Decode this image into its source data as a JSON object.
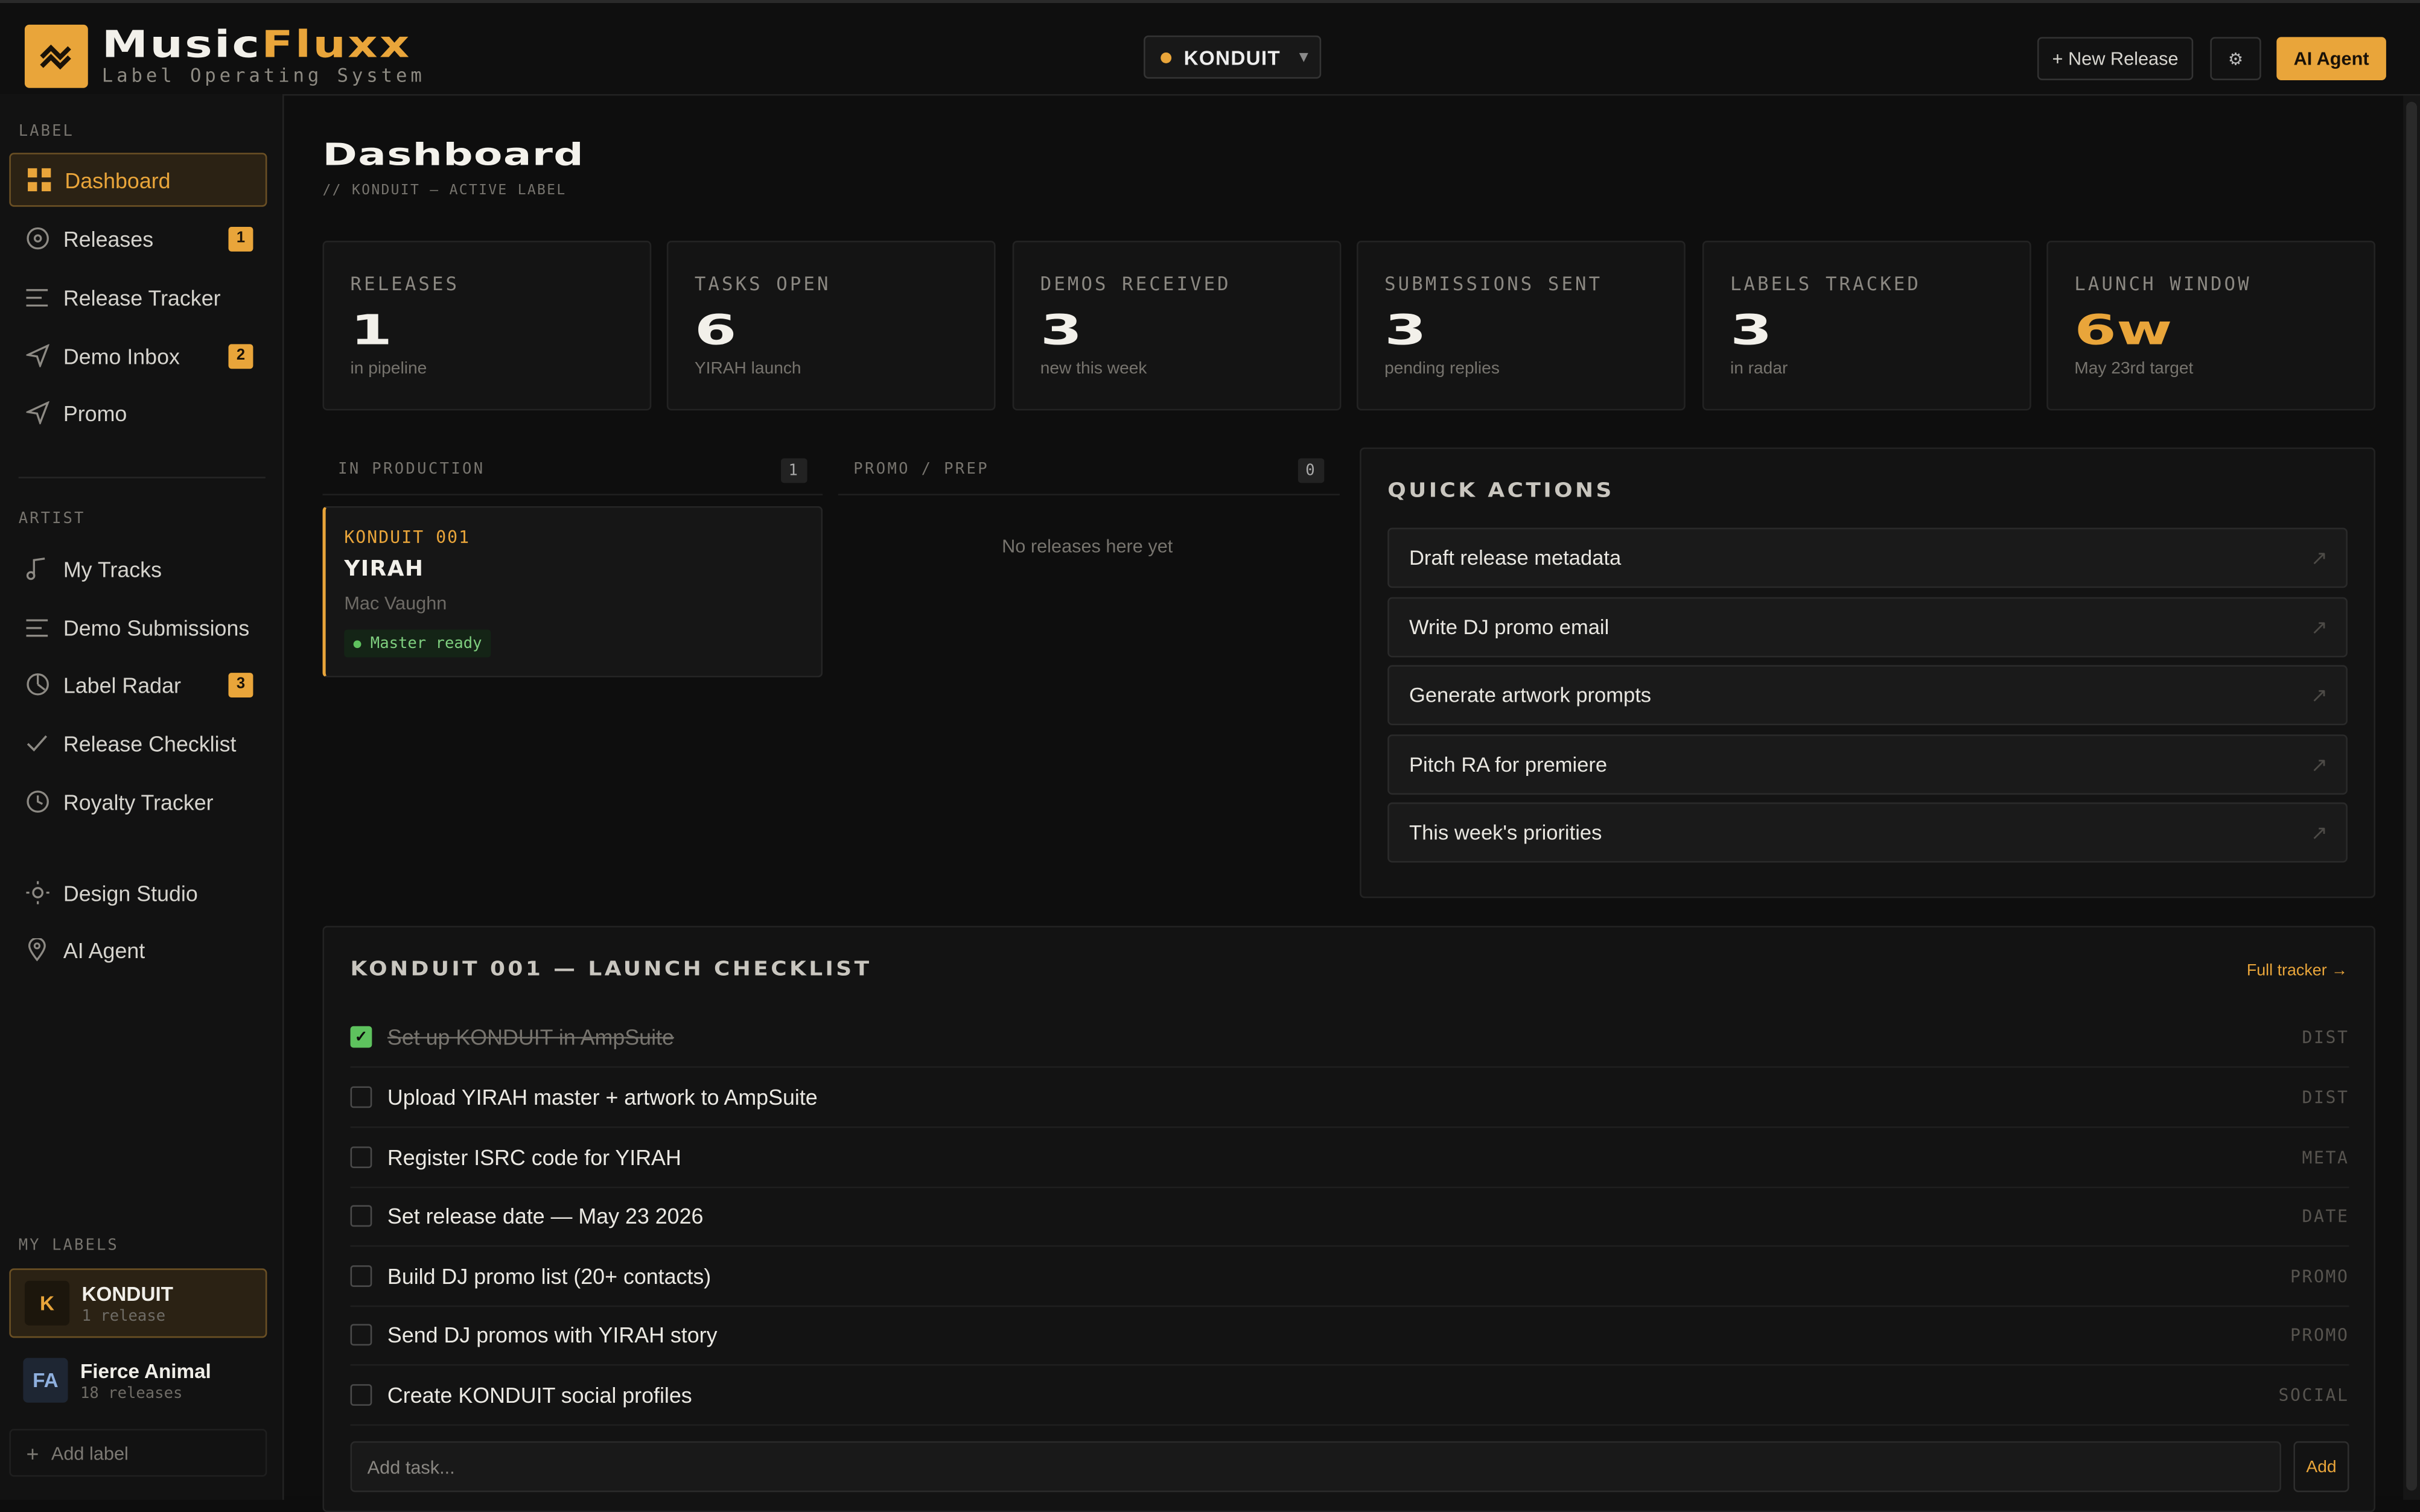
{
  "app": {
    "name_part1": "Music",
    "name_part2": "Fluxx",
    "subtitle": "Label Operating System",
    "accent": "#e9a53a"
  },
  "header": {
    "label_selector": "KONDUIT",
    "new_release": "+ New Release",
    "settings_icon": "gear-icon",
    "ai_agent": "AI Agent"
  },
  "sidebar": {
    "label_section": "LABEL",
    "label_items": [
      {
        "label": "Dashboard",
        "icon": "grid-icon",
        "active": true
      },
      {
        "label": "Releases",
        "icon": "disc-icon",
        "badge": "1"
      },
      {
        "label": "Release Tracker",
        "icon": "list-icon"
      },
      {
        "label": "Demo Inbox",
        "icon": "send-icon",
        "badge": "2"
      },
      {
        "label": "Promo",
        "icon": "send-icon"
      }
    ],
    "artist_section": "ARTIST",
    "artist_items": [
      {
        "label": "My Tracks",
        "icon": "music-note-icon"
      },
      {
        "label": "Demo Submissions",
        "icon": "list-icon"
      },
      {
        "label": "Label Radar",
        "icon": "radar-icon",
        "badge": "3"
      },
      {
        "label": "Release Checklist",
        "icon": "check-icon"
      },
      {
        "label": "Royalty Tracker",
        "icon": "clock-icon"
      }
    ],
    "tool_items": [
      {
        "label": "Design Studio",
        "icon": "sun-icon"
      },
      {
        "label": "AI Agent",
        "icon": "pin-icon"
      }
    ],
    "my_labels_section": "MY LABELS",
    "labels": [
      {
        "initials": "K",
        "name": "KONDUIT",
        "count": "1 release"
      },
      {
        "initials": "FA",
        "name": "Fierce Animal",
        "count": "18 releases"
      }
    ],
    "add_label": "Add label"
  },
  "main": {
    "title": "Dashboard",
    "subtitle": "// KONDUIT — ACTIVE LABEL",
    "stats": [
      {
        "label": "RELEASES",
        "value": "1",
        "note": "in pipeline"
      },
      {
        "label": "TASKS OPEN",
        "value": "6",
        "note": "YIRAH launch"
      },
      {
        "label": "DEMOS RECEIVED",
        "value": "3",
        "note": "new this week"
      },
      {
        "label": "SUBMISSIONS SENT",
        "value": "3",
        "note": "pending replies"
      },
      {
        "label": "LABELS TRACKED",
        "value": "3",
        "note": "in radar"
      },
      {
        "label": "LAUNCH WINDOW",
        "value": "6w",
        "note": "May 23rd target"
      }
    ],
    "columns": [
      {
        "title": "IN PRODUCTION",
        "count": "1"
      },
      {
        "title": "PROMO / PREP",
        "count": "0",
        "empty": "No releases here yet"
      }
    ],
    "release_card": {
      "catalog": "KONDUIT 001",
      "title": "YIRAH",
      "artist": "Mac Vaughn",
      "status": "Master ready"
    },
    "quick_actions": {
      "title": "QUICK ACTIONS",
      "items": [
        "Draft release metadata",
        "Write DJ promo email",
        "Generate artwork prompts",
        "Pitch RA for premiere",
        "This week's priorities"
      ]
    },
    "checklist": {
      "title": "KONDUIT 001 — LAUNCH CHECKLIST",
      "full_tracker": "Full tracker →",
      "tasks": [
        {
          "text": "Set up KONDUIT in AmpSuite",
          "tag": "DIST",
          "done": true
        },
        {
          "text": "Upload YIRAH master + artwork to AmpSuite",
          "tag": "DIST",
          "done": false
        },
        {
          "text": "Register ISRC code for YIRAH",
          "tag": "META",
          "done": false
        },
        {
          "text": "Set release date — May 23 2026",
          "tag": "DATE",
          "done": false
        },
        {
          "text": "Build DJ promo list (20+ contacts)",
          "tag": "PROMO",
          "done": false
        },
        {
          "text": "Send DJ promos with YIRAH story",
          "tag": "PROMO",
          "done": false
        },
        {
          "text": "Create KONDUIT social profiles",
          "tag": "SOCIAL",
          "done": false
        }
      ],
      "add_placeholder": "Add task...",
      "add_button": "Add"
    }
  }
}
